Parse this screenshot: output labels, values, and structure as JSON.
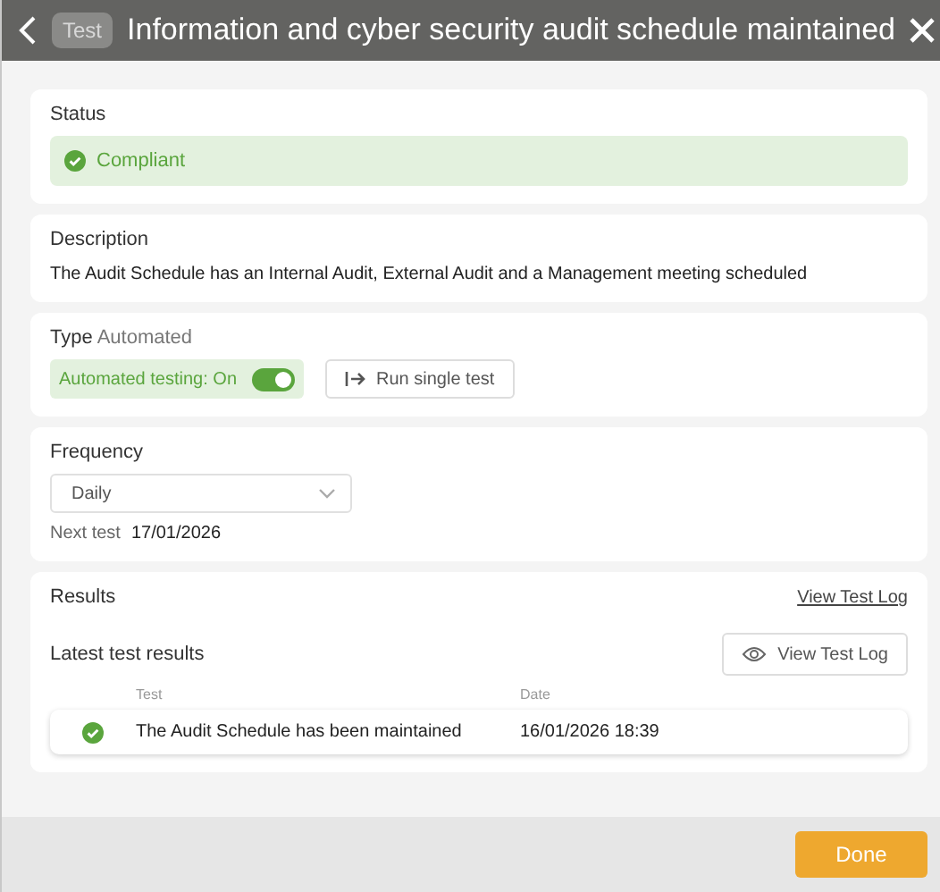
{
  "header": {
    "badge": "Test",
    "title": "Information and cyber security audit schedule maintained"
  },
  "status": {
    "label": "Status",
    "value": "Compliant",
    "passed": true
  },
  "description": {
    "label": "Description",
    "text": "The Audit Schedule has an Internal Audit, External Audit and a Management meeting scheduled"
  },
  "type": {
    "label": "Type",
    "value": "Automated",
    "toggle": {
      "label": "Automated testing: On",
      "on": true
    },
    "button": "Run single test"
  },
  "frequency": {
    "label": "Frequency",
    "select": "Daily",
    "next_label": "Next test",
    "next_value": "17/01/2026"
  },
  "results": {
    "label": "Results",
    "link": "View Test Log",
    "subtitle": "Latest test results",
    "button": "View Test Log",
    "columns": [
      "Test",
      "Date"
    ],
    "rows": [
      {
        "test": "The Audit Schedule has been maintained",
        "date": "16/01/2026 18:39",
        "passed": true
      }
    ]
  },
  "footer": {
    "done": "Done"
  }
}
